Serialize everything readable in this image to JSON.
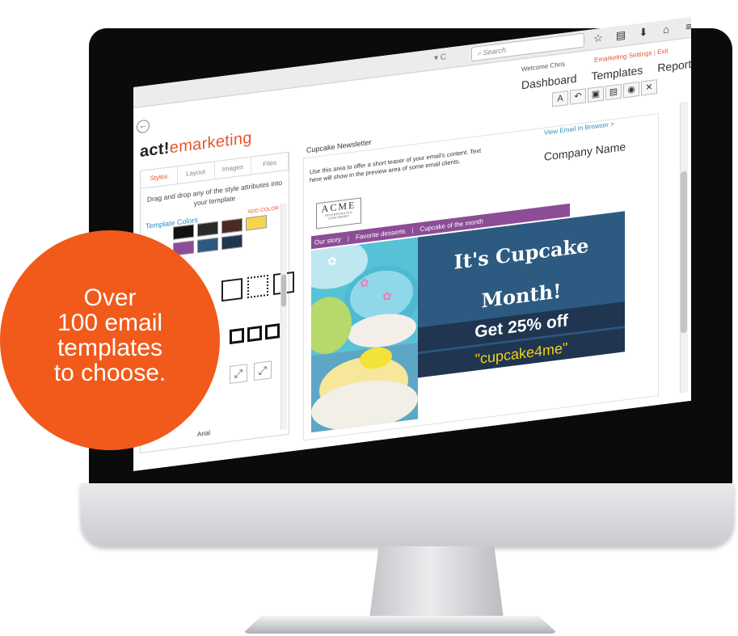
{
  "browser": {
    "search_placeholder": "Search",
    "toolbar_icons": [
      "star-icon",
      "reader-icon",
      "download-icon",
      "home-icon",
      "menu-icon"
    ],
    "reload_glyph": "▾ C"
  },
  "header": {
    "welcome": "Welcome Chris",
    "settings_link": "Emarketing Settings",
    "exit_link": "Exit",
    "nav": [
      "Dashboard",
      "Templates",
      "Reports"
    ]
  },
  "logo": {
    "bold": "act!",
    "rest": "emarketing"
  },
  "editor_toolbar": [
    {
      "icon": "font-icon",
      "glyph": "A"
    },
    {
      "icon": "undo-icon",
      "glyph": "↶"
    },
    {
      "icon": "save-icon",
      "glyph": "▣"
    },
    {
      "icon": "save-as-icon",
      "glyph": "▤"
    },
    {
      "icon": "preview-icon",
      "glyph": "◉"
    },
    {
      "icon": "close-icon",
      "glyph": "✕"
    }
  ],
  "style_panel": {
    "tabs": [
      "Styles",
      "Layout",
      "Images",
      "Files"
    ],
    "hint": "Drag and drop any of the style attributes into your template",
    "colors_title": "Template Colors",
    "add_color": "ADD COLOR",
    "swatches": [
      "#111111",
      "#2a2a2a",
      "#4a2a24",
      "#f5d64a",
      "#8c4d96",
      "#2d5a80",
      "#1f3550",
      ""
    ],
    "font_value": "Arial"
  },
  "newsletter": {
    "title": "Cupcake Newsletter",
    "teaser": "Use this area to offer a short teaser of your email's content. Text here will show in the preview area of some email clients.",
    "view_in_browser": "View Email In Browser >",
    "company_name": "Company Name",
    "logo": {
      "name": "ACME",
      "sub": "INCORPORATED",
      "foot": "LOGO SOCKET"
    },
    "menu": [
      "Our story",
      "Favorite desserts",
      "Cupcake of the month"
    ],
    "banner_line1": "It's Cupcake",
    "banner_line2": "Month!",
    "offer": "Get 25% off",
    "promo_code": "\"cupcake4me\""
  },
  "promo_badge": {
    "lines": [
      "Over",
      "100 email",
      "templates",
      "to choose."
    ]
  },
  "colors": {
    "accent": "#f15a1a",
    "link": "#2c8fbf",
    "menu_purple": "#8c4d96",
    "banner_blue": "#2d5a80",
    "code_yellow": "#f3d21a"
  }
}
